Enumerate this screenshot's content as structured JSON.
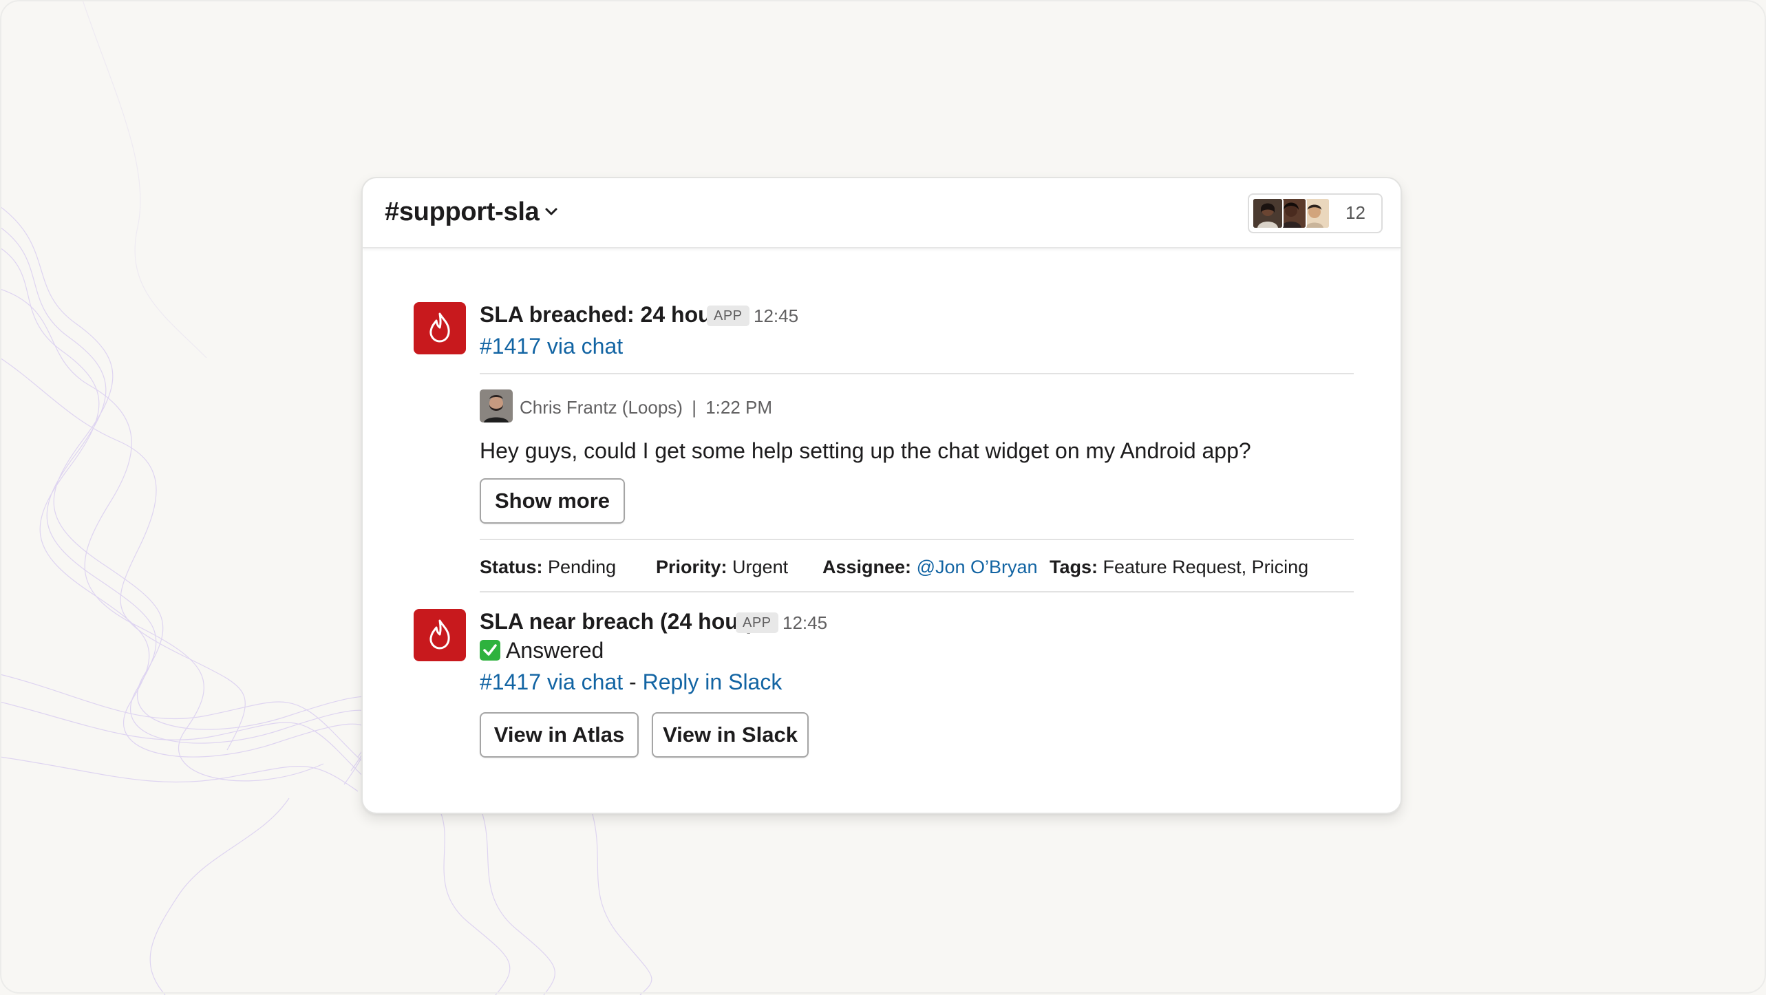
{
  "channel": {
    "name": "#support-sla",
    "member_count": "12"
  },
  "messages": [
    {
      "title": "SLA breached: 24 hour",
      "badge": "APP",
      "time": "12:45",
      "ticket_link": "#1417 via chat",
      "quote": {
        "author": "Chris Frantz (Loops)",
        "separator": "|",
        "time": "1:22 PM",
        "text": "Hey guys, could I get some help setting up the chat widget on my Android app?"
      },
      "show_more_label": "Show more",
      "fields": {
        "status_label": "Status:",
        "status_value": "Pending",
        "priority_label": "Priority:",
        "priority_value": "Urgent",
        "assignee_label": "Assignee:",
        "assignee_value": "@Jon O’Bryan",
        "tags_label": "Tags:",
        "tags_value": "Feature Request, Pricing"
      }
    },
    {
      "title": "SLA near breach (24 hour)",
      "badge": "APP",
      "time": "12:45",
      "status_text": "Answered",
      "ticket_link": "#1417 via chat",
      "link_separator": " - ",
      "reply_link": "Reply in Slack",
      "buttons": [
        "View in Atlas",
        "View in Slack"
      ]
    }
  ],
  "icons": {
    "app": "flame-icon",
    "dropdown": "chevron-down-icon",
    "answered": "check-mark-icon"
  },
  "colors": {
    "app_icon": "#c8191d",
    "link": "#1264a3",
    "check": "#2eb23e"
  }
}
